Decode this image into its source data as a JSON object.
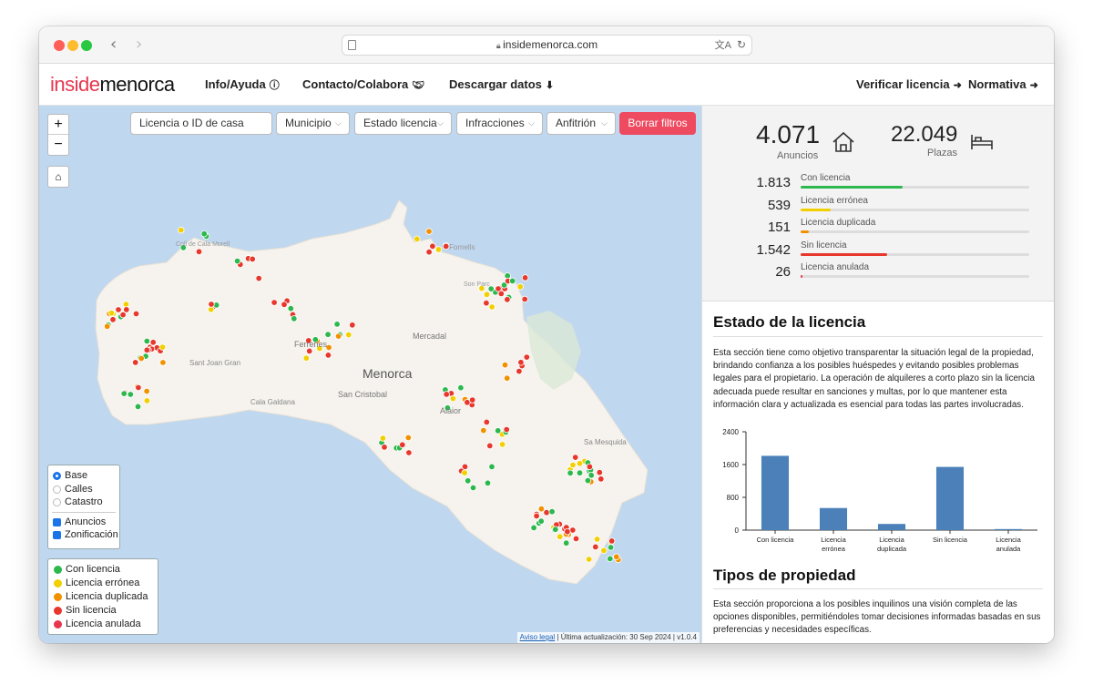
{
  "browser": {
    "url": "insidemenorca.com"
  },
  "logo": {
    "part1": "inside",
    "part2": "menorca"
  },
  "nav": {
    "info": "Info/Ayuda",
    "contact": "Contacto/Colabora",
    "download": "Descargar datos",
    "verify": "Verificar licencia",
    "rules": "Normativa"
  },
  "filters": {
    "search_placeholder": "Licencia o ID de casa",
    "municipio": "Municipio",
    "estado": "Estado licencia",
    "infracciones": "Infracciones",
    "anfitrion": "Anfitrión",
    "clear": "Borrar filtros"
  },
  "map": {
    "labels": [
      "Menorca",
      "Ferreries",
      "Mercadal",
      "Sant Joan Gran",
      "San Cristobal",
      "Cala Galdana",
      "Alaior",
      "Sa Mesquida",
      "Coll de Cala Morell",
      "Fornells",
      "Son Parc"
    ],
    "layers": {
      "base": "Base",
      "streets": "Calles",
      "cadastre": "Catastro",
      "listings": "Anuncios",
      "zoning": "Zonificación"
    },
    "legend": [
      {
        "label": "Con licencia",
        "color": "#2db84d"
      },
      {
        "label": "Licencia errónea",
        "color": "#f2d000"
      },
      {
        "label": "Licencia duplicada",
        "color": "#f29100"
      },
      {
        "label": "Sin licencia",
        "color": "#e8372c"
      },
      {
        "label": "Licencia anulada",
        "color": "#e8364f"
      }
    ],
    "footer_link": "Aviso legal",
    "footer_text": "| Última actualización: 30 Sep 2024 | v1.0.4"
  },
  "summary": {
    "anuncios_value": "4.071",
    "anuncios_label": "Anuncios",
    "plazas_value": "22.049",
    "plazas_label": "Plazas",
    "rows": [
      {
        "n": "1.813",
        "label": "Con licencia",
        "frac": 0.445,
        "color": "#2db84d"
      },
      {
        "n": "539",
        "label": "Licencia errónea",
        "frac": 0.132,
        "color": "#f2d000"
      },
      {
        "n": "151",
        "label": "Licencia duplicada",
        "frac": 0.037,
        "color": "#f29100"
      },
      {
        "n": "1.542",
        "label": "Sin licencia",
        "frac": 0.379,
        "color": "#e8372c"
      },
      {
        "n": "26",
        "label": "Licencia anulada",
        "frac": 0.006,
        "color": "#e8364f"
      }
    ]
  },
  "section1": {
    "title": "Estado de la licencia",
    "text": "Esta sección tiene como objetivo transparentar la situación legal de la propiedad, brindando confianza a los posibles huéspedes y evitando posibles problemas legales para el propietario. La operación de alquileres a corto plazo sin la licencia adecuada puede resultar en sanciones y multas, por lo que mantener esta información clara y actualizada es esencial para todas las partes involucradas."
  },
  "chart_data": {
    "type": "bar",
    "categories": [
      "Con licencia",
      "Licencia errónea",
      "Licencia duplicada",
      "Sin licencia",
      "Licencia anulada"
    ],
    "values": [
      1813,
      539,
      151,
      1542,
      26
    ],
    "yticks": [
      "0",
      "800",
      "1600",
      "2400"
    ],
    "ylim": [
      0,
      2400
    ],
    "color": "#4b81b8",
    "grid": false
  },
  "section2": {
    "title": "Tipos de propiedad",
    "text": "Esta sección proporciona a los posibles inquilinos una visión completa de las opciones disponibles, permitiéndoles tomar decisiones informadas basadas en sus preferencias y necesidades específicas."
  }
}
